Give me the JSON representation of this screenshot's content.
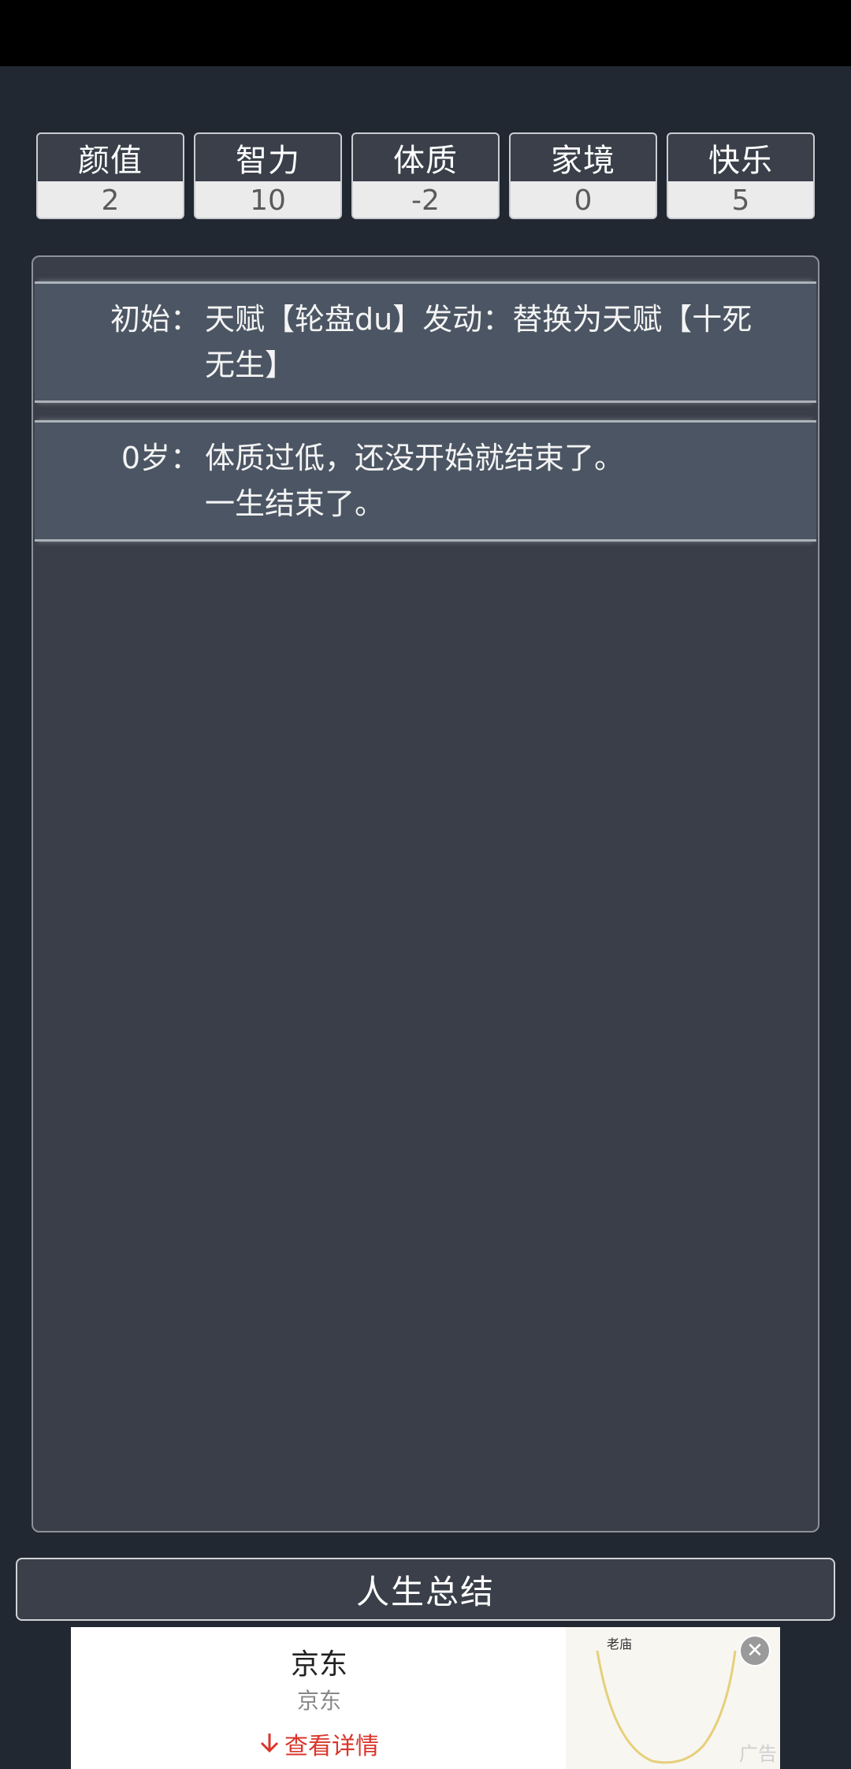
{
  "stats": [
    {
      "name": "颜值",
      "value": "2"
    },
    {
      "name": "智力",
      "value": "10"
    },
    {
      "name": "体质",
      "value": "-2"
    },
    {
      "name": "家境",
      "value": "0"
    },
    {
      "name": "快乐",
      "value": "5"
    }
  ],
  "log": [
    {
      "age": "初始：",
      "lines": [
        "天赋【轮盘du】发动：替换为天赋【十死",
        "无生】"
      ]
    },
    {
      "age": "0岁：",
      "lines": [
        "体质过低，还没开始就结束了。",
        "一生结束了。"
      ]
    }
  ],
  "summary_button": "人生总结",
  "ad": {
    "brand": "京东",
    "subtitle": "京东",
    "cta": "查看详情",
    "image_logo": "老庙",
    "label": "广告",
    "close_icon": "close-icon",
    "download_icon": "arrow-down-icon"
  },
  "colors": {
    "background": "#222831",
    "panel": "#393e48",
    "entry": "#4b5563",
    "cta": "#d9352b"
  }
}
